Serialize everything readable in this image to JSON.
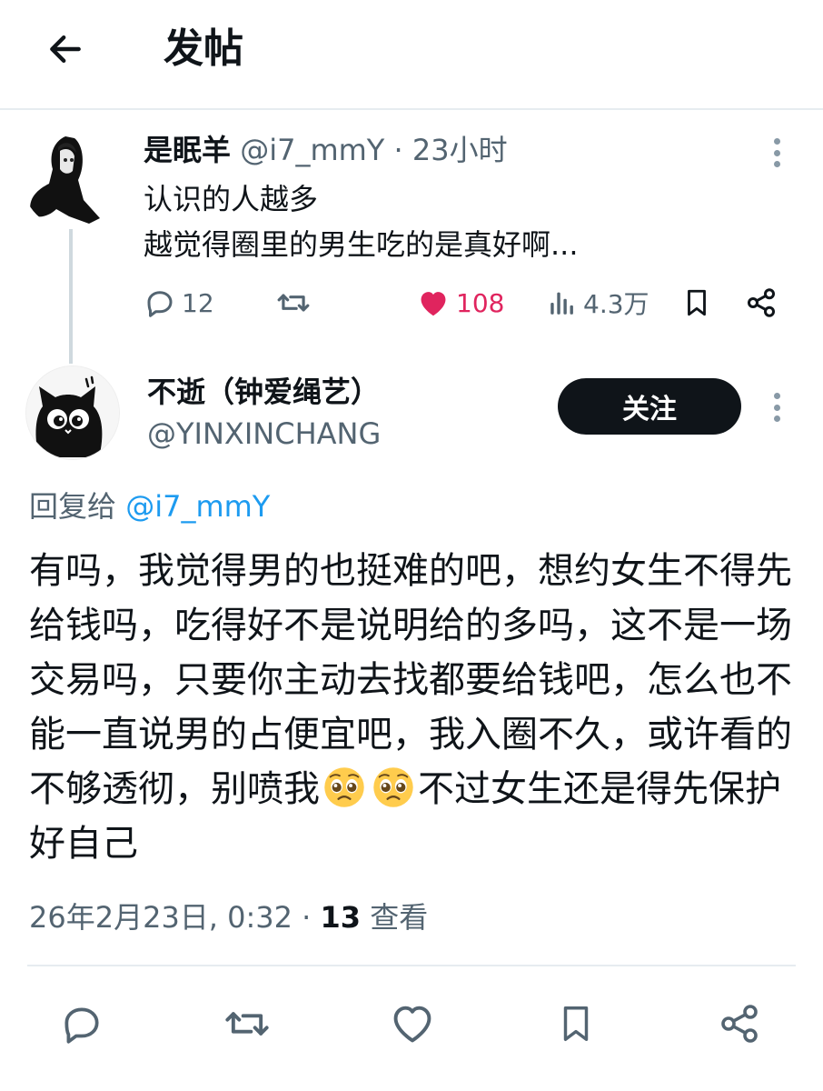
{
  "header": {
    "title": "发帖"
  },
  "parent_tweet": {
    "name": "是眠羊",
    "handle": "@i7_mmY",
    "time": "23小时",
    "text_line1": "认识的人越多",
    "text_line2": "越觉得圈里的男生吃的是真好啊...",
    "stats": {
      "replies": "12",
      "likes": "108",
      "views": "4.3万"
    }
  },
  "reply_tweet": {
    "name": "不逝（钟爱绳艺）",
    "handle": "@YINXINCHANG",
    "follow_label": "关注",
    "reply_to_label": "回复给",
    "reply_to_handle": "@i7_mmY",
    "text_part1": "有吗，我觉得男的也挺难的吧，想约女生不得先给钱吗，吃得好不是说明给的多吗，这不是一场交易吗，只要你主动去找都要给钱吧，怎么也不能一直说男的占便宜吧，我入圈不久，或许看的不够透彻，别喷我",
    "emojis": [
      "pleading-face",
      "pleading-face"
    ],
    "text_part2": "不过女生还是得先保护好自己",
    "timestamp": "26年2月23日, 0:32 · ",
    "views_count": "13",
    "views_label": " 查看"
  },
  "colors": {
    "accent": "#1d9bf0",
    "like": "#e0245e",
    "muted": "#536471",
    "text": "#0f1419"
  },
  "icons": [
    "back-arrow-icon",
    "more-icon",
    "reply-icon",
    "retweet-icon",
    "heart-icon",
    "views-icon",
    "bookmark-icon",
    "share-icon"
  ]
}
